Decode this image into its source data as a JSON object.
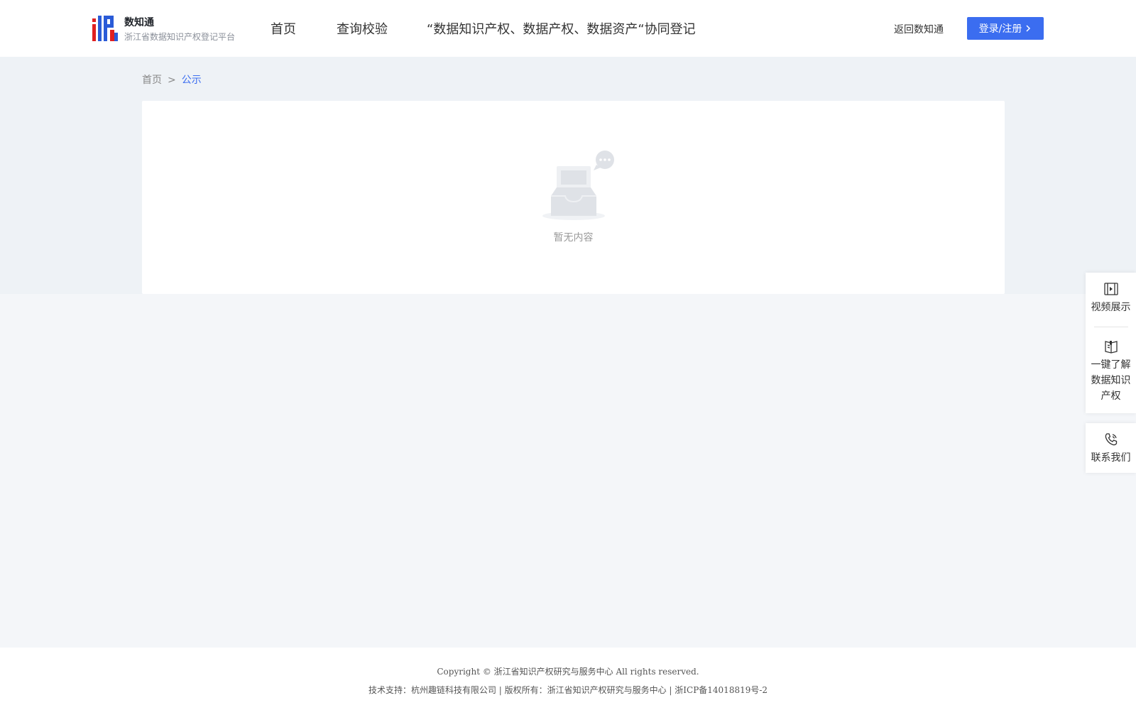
{
  "header": {
    "logo_title": "数知通",
    "logo_subtitle": "浙江省数据知识产权登记平台",
    "nav": [
      {
        "label": "首页"
      },
      {
        "label": "查询校验"
      },
      {
        "label": "“数据知识产权、数据产权、数据资产“协同登记"
      }
    ],
    "back_label": "返回数知通",
    "login_label": "登录/注册",
    "colors": {
      "accent": "#3b6df0",
      "logo_red": "#e02020",
      "logo_blue": "#2a5bd7"
    }
  },
  "breadcrumb": {
    "home": "首页",
    "separator": ">",
    "current": "公示"
  },
  "content": {
    "empty_text": "暂无内容"
  },
  "float_panel": {
    "items": [
      {
        "label": "视频展示",
        "icon": "video-icon"
      },
      {
        "label": "一键了解数据知识产权",
        "icon": "book-icon"
      },
      {
        "label": "联系我们",
        "icon": "phone-icon"
      }
    ]
  },
  "footer": {
    "copyright": "Copyright © 浙江省知识产权研究与服务中心 All rights reserved.",
    "support": "技术支持：杭州趣链科技有限公司 | 版权所有：浙江省知识产权研究与服务中心 | 浙ICP备14018819号-2"
  }
}
